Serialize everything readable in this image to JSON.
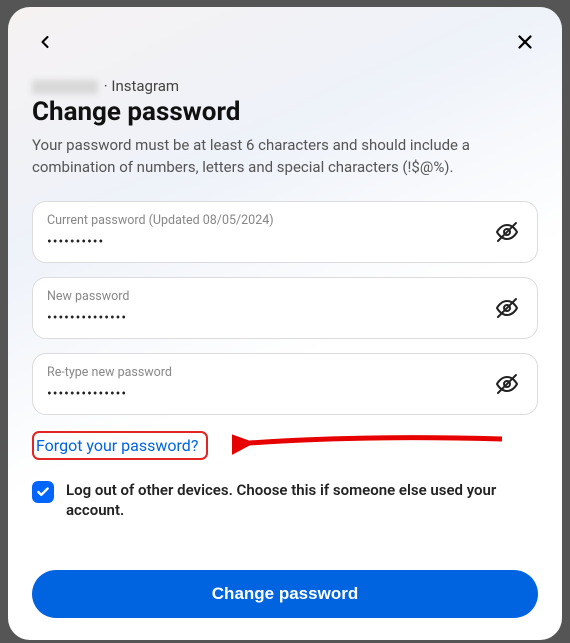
{
  "userline": {
    "platform": "Instagram",
    "separator": " · "
  },
  "title": "Change password",
  "description": "Your password must be at least 6 characters and should include a combination of numbers, letters and special characters (!$@%).",
  "fields": {
    "current": {
      "label": "Current password (Updated 08/05/2024)",
      "dots": "••••••••••"
    },
    "new": {
      "label": "New password",
      "dots": "••••••••••••••"
    },
    "retype": {
      "label": "Re-type new password",
      "dots": "••••••••••••••"
    }
  },
  "forgot": "Forgot your password?",
  "logout_label": "Log out of other devices. Choose this if someone else used your account.",
  "submit": "Change password",
  "annotation": {
    "arrow_color": "#e60000",
    "highlight_color": "#e32424"
  }
}
